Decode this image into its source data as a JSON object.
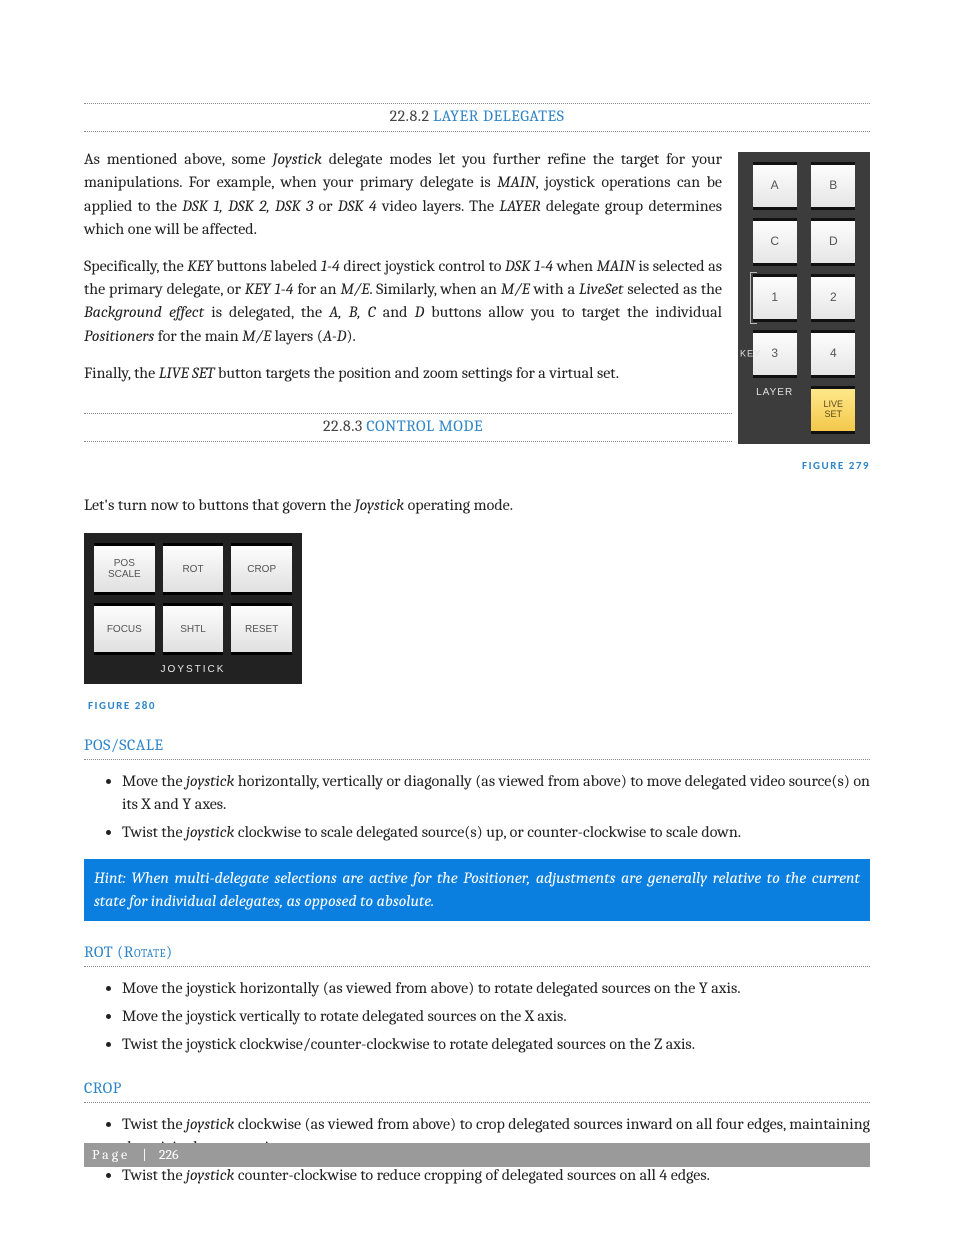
{
  "sections": {
    "layer_delegates": {
      "num": "22.8.2",
      "title": "LAYER DELEGATES"
    },
    "control_mode": {
      "num": "22.8.3",
      "title": "CONTROL MODE"
    }
  },
  "paragraphs": {
    "p1a": "As mentioned above, some ",
    "p1b": " delegate modes let you further refine the target for your manipulations.  For example, when your primary delegate is ",
    "p1c": ", joystick operations can be applied to the ",
    "p1d": " or ",
    "p1e": " video layers. The ",
    "p1f": " delegate group determines which one will be affected.",
    "p2a": "Specifically, the ",
    "p2b": " buttons labeled ",
    "p2c": " direct joystick control to ",
    "p2d": " when ",
    "p2e": " is selected as the primary delegate, or ",
    "p2f": " for an ",
    "p2g": ". Similarly, when an ",
    "p2h": " with a ",
    "p2i": " selected as the ",
    "p2j": " is delegated, the ",
    "p2k": " and ",
    "p2l": " buttons allow you to target the individual ",
    "p2m": " for the main ",
    "p2n": " layers (",
    "p2o": ").",
    "p3a": "Finally, the ",
    "p3b": " button targets the position and zoom settings for a virtual set.",
    "p4a": "Let's turn now to buttons that govern the ",
    "p4b": " operating mode."
  },
  "italics": {
    "joystick": "Joystick",
    "main": "MAIN",
    "dsk123": "DSK 1, DSK 2, DSK 3",
    "dsk4": "DSK 4",
    "layer": "LAYER",
    "key": "KEY",
    "one_four": "1-4",
    "dsk1_4": "DSK 1-4",
    "key1_4": "KEY 1-4",
    "me": "M/E",
    "liveset": "LiveSet",
    "bg_effect": "Background effect",
    "abc": "A, B, C",
    "d": "D",
    "positioners": "Positioners",
    "a_d": "A-D",
    "live_set_btn": "LIVE SET",
    "joystick2": "joystick"
  },
  "panel279": {
    "buttons": [
      "A",
      "B",
      "C",
      "D",
      "1",
      "2",
      "3",
      "4"
    ],
    "key_label": "KEY",
    "layer_label": "LAYER",
    "live_set_top": "LIVE",
    "live_set_bot": "SET",
    "caption": "FIGURE 279"
  },
  "panel280": {
    "buttons": {
      "pos_top": "POS",
      "pos_bot": "SCALE",
      "rot": "ROT",
      "crop": "CROP",
      "focus": "FOCUS",
      "shtl": "SHTL",
      "reset": "RESET"
    },
    "label": "JOYSTICK",
    "caption": "FIGURE 280"
  },
  "subsections": {
    "pos_scale": "POS/SCALE",
    "rot": "ROT (Rotate)",
    "crop": "CROP"
  },
  "lists": {
    "pos_scale": [
      {
        "a": "Move the ",
        "i": "joystick",
        "b": " horizontally, vertically or diagonally (as viewed from above) to move delegated video source(s) on its X and Y axes."
      },
      {
        "a": "Twist the ",
        "i": "joystick",
        "b": " clockwise to scale delegated source(s) up, or counter-clockwise to scale down."
      }
    ],
    "rot": [
      "Move the joystick horizontally (as viewed from above) to rotate delegated sources on the Y axis.",
      " Move the joystick vertically to rotate delegated sources on the X axis.",
      "Twist the joystick clockwise/counter-clockwise to rotate delegated sources on the Z axis."
    ],
    "crop": [
      {
        "a": "Twist the ",
        "i": "joystick",
        "b": " clockwise (as viewed from above) to crop delegated sources inward on all four edges, maintaining the original aspect ratio."
      },
      {
        "a": "Twist the ",
        "i": "joystick",
        "b": " counter-clockwise to reduce cropping of delegated sources on all 4 edges."
      }
    ]
  },
  "hint": "Hint: When multi-delegate selections are active for the Positioner, adjustments are generally relative to the current state for individual delegates, as opposed to absolute.",
  "footer": {
    "label": "Page",
    "sep": "|",
    "num": "226"
  }
}
